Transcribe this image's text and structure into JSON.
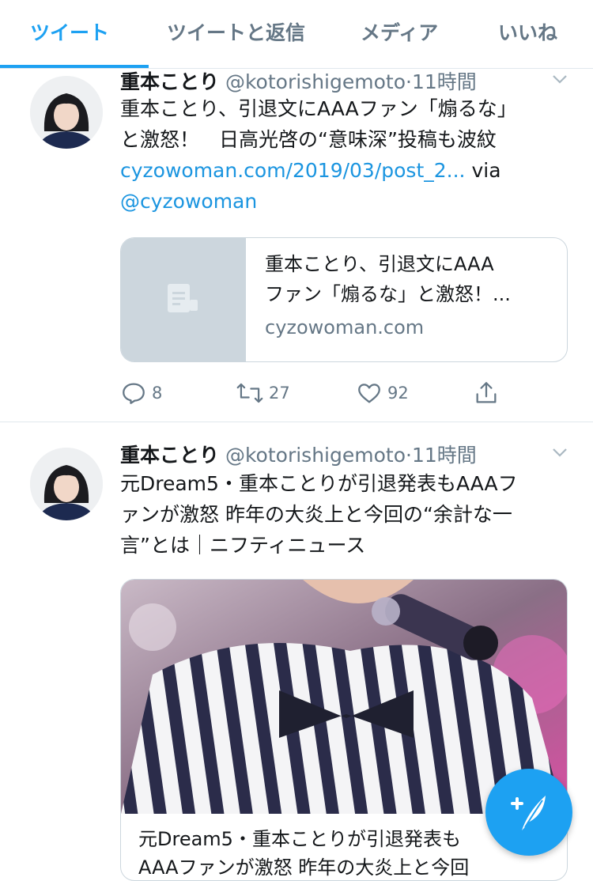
{
  "tabs": [
    {
      "label": "ツイート",
      "active": true
    },
    {
      "label": "ツイートと返信",
      "active": false
    },
    {
      "label": "メディア",
      "active": false
    },
    {
      "label": "いいね",
      "active": false
    }
  ],
  "tweets": [
    {
      "name": "重本ことり",
      "handle": "@kotorishigemoto",
      "dot": "·",
      "time": "11時間",
      "text_line1": "重本ことり、引退文にAAAファン「煽るな」",
      "text_line2": "と激怒！　日高光啓の“意味深”投稿も波紋",
      "link": "cyzowoman.com/2019/03/post_2...",
      "via": " via",
      "mention": "@cyzowoman",
      "card": {
        "title_line1": "重本ことり、引退文にAAA",
        "title_line2": "ファン「煽るな」と激怒！...",
        "domain": "cyzowoman.com"
      },
      "actions": {
        "replies": "8",
        "retweets": "27",
        "likes": "92"
      }
    },
    {
      "name": "重本ことり",
      "handle": "@kotorishigemoto",
      "dot": "·",
      "time": "11時間",
      "text_line1": "元Dream5・重本ことりが引退発表もAAAフ",
      "text_line2": "ァンが激怒 昨年の大炎上と今回の“余計な一",
      "text_line3": "言”とは｜ニフティニュース",
      "card": {
        "title_line1": "元Dream5・重本ことりが引退発表も",
        "title_line2": "AAAファンが激怒 昨年の大炎上と今回"
      }
    }
  ],
  "colors": {
    "accent": "#1da1f2",
    "link": "#1b95e0",
    "muted": "#657786"
  }
}
